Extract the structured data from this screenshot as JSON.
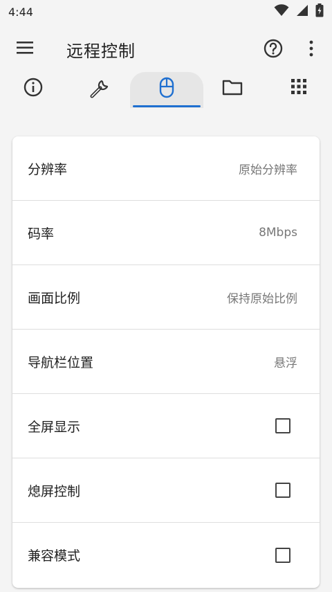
{
  "status_bar": {
    "time": "4:44"
  },
  "app_bar": {
    "title": "远程控制"
  },
  "tabs": [
    {
      "icon": "info-icon",
      "active": false
    },
    {
      "icon": "wrench-icon",
      "active": true
    },
    {
      "icon": "mouse-icon",
      "active": true
    },
    {
      "icon": "folder-icon",
      "active": false
    },
    {
      "icon": "apps-grid-icon",
      "active": false
    }
  ],
  "settings": {
    "resolution": {
      "label": "分辨率",
      "value": "原始分辨率"
    },
    "bitrate": {
      "label": "码率",
      "value": "8Mbps"
    },
    "aspect_ratio": {
      "label": "画面比例",
      "value": "保持原始比例"
    },
    "navbar_position": {
      "label": "导航栏位置",
      "value": "悬浮"
    },
    "fullscreen": {
      "label": "全屏显示",
      "checked": false
    },
    "screen_off_control": {
      "label": "熄屏控制",
      "checked": false
    },
    "compat_mode": {
      "label": "兼容模式",
      "checked": false
    }
  },
  "colors": {
    "accent": "#1e6fd0",
    "background": "#f4f4f4",
    "card": "#ffffff"
  }
}
